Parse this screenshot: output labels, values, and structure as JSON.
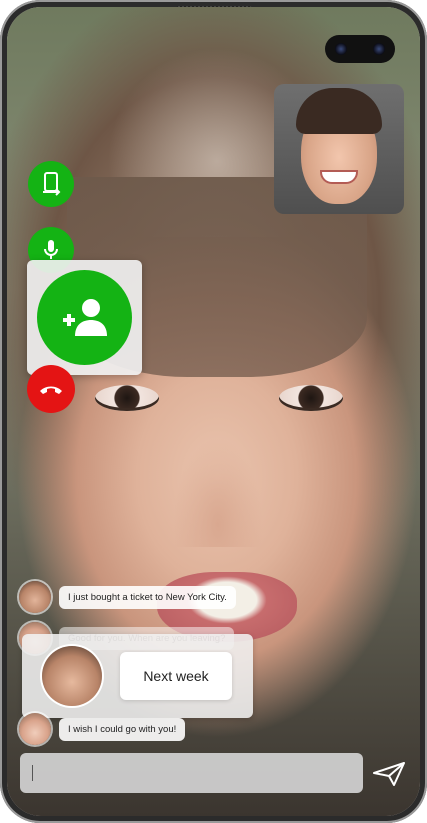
{
  "call": {
    "remote_video_label": "",
    "self_preview_label": ""
  },
  "controls": {
    "flip_camera_icon": "phone-rotate-icon",
    "mic_icon": "microphone-icon",
    "add_person_icon": "add-person-icon",
    "hangup_icon": "phone-hangup-icon"
  },
  "chat": {
    "messages": [
      {
        "text": "I just bought a ticket to New York City."
      },
      {
        "text": "Good for you. When are you leaving?"
      },
      {
        "text": "I wish I could go with you!"
      }
    ],
    "reply": {
      "text": "Next week"
    }
  },
  "composer": {
    "value": "",
    "placeholder": ""
  },
  "colors": {
    "accept_green": "#14b314",
    "hangup_red": "#e41414"
  }
}
